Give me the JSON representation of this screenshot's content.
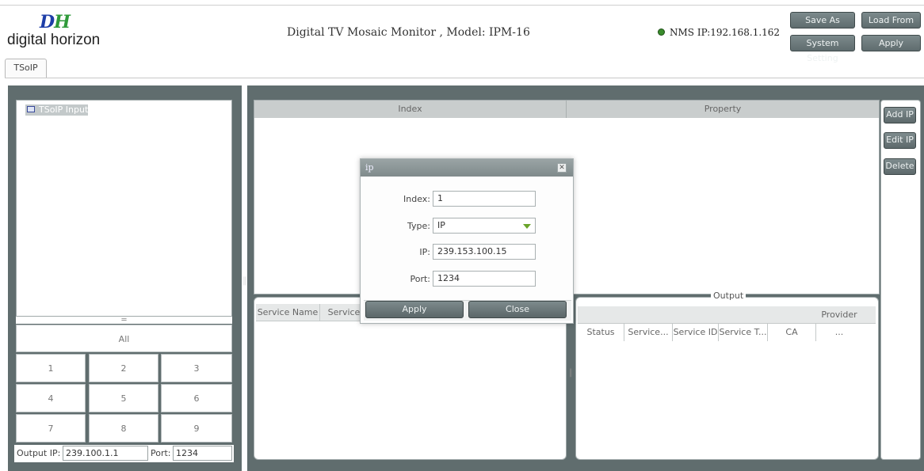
{
  "header": {
    "logo_mark": "DH",
    "logo_text": "digital horizon",
    "app_title": "Digital TV Mosaic Monitor , Model: IPM-16",
    "nms_ip": "NMS IP:192.168.1.162",
    "buttons": {
      "save_as": "Save As",
      "load_from": "Load From",
      "system_setting": "System Setting",
      "apply": "Apply"
    }
  },
  "tabs": [
    {
      "label": "TSoIP",
      "active": true
    }
  ],
  "left_panel": {
    "tree_root": "TSoIP Input",
    "all_label": "All",
    "grid": [
      "1",
      "2",
      "3",
      "4",
      "5",
      "6",
      "7",
      "8",
      "9"
    ],
    "output_ip_label": "Output IP:",
    "output_ip_value": "239.100.1.1",
    "port_label": "Port:",
    "port_value": "1234"
  },
  "right_panel": {
    "table_headers": [
      "Index",
      "Property"
    ],
    "side_buttons": [
      "Add IP",
      "Edit IP",
      "Delete"
    ],
    "input_service_headers": [
      "Service Name",
      "Service"
    ],
    "output_legend": "Output",
    "output_headers": [
      "Status",
      "Service...",
      "Service ID",
      "Service T...",
      "CA",
      "Provider ..."
    ]
  },
  "dialog": {
    "title": "ip",
    "index_label": "Index:",
    "index_value": "1",
    "type_label": "Type:",
    "type_value": "IP",
    "ip_label": "IP:",
    "ip_value": "239.153.100.15",
    "port_label": "Port:",
    "port_value": "1234",
    "apply": "Apply",
    "close": "Close"
  },
  "colors": {
    "panel_bg": "#606d6e",
    "button_bg": "#6d7a7c",
    "logo_blue": "#1e3ea8",
    "logo_green": "#2f9a3a",
    "status_green": "#3a8c2c",
    "dropdown_arrow": "#6aa42a"
  }
}
